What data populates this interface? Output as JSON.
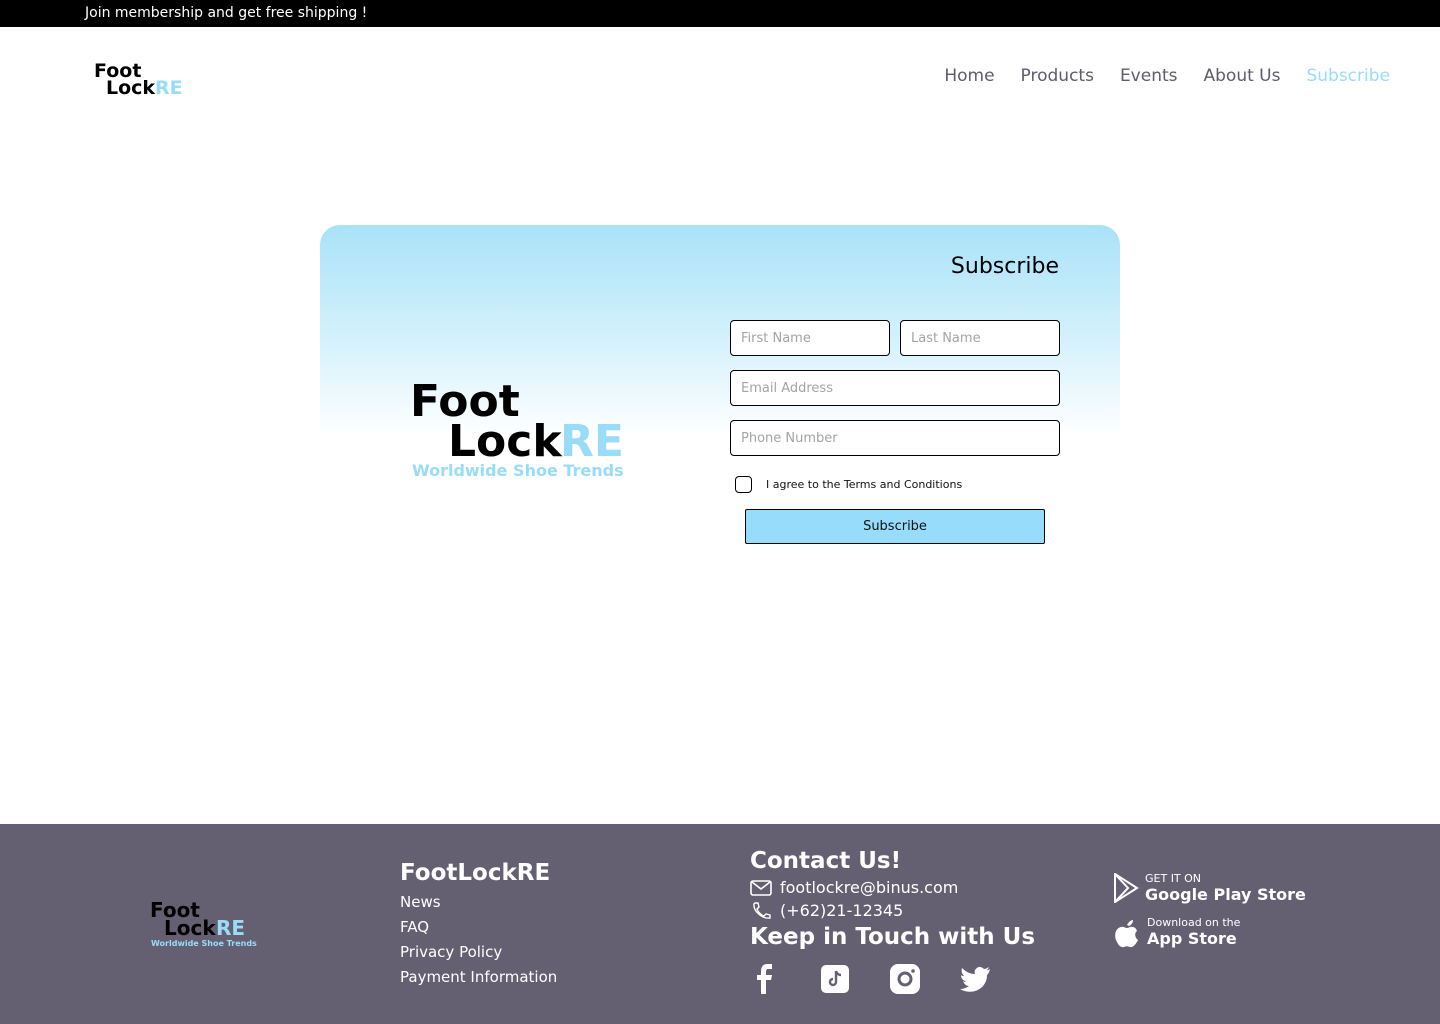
{
  "promo": {
    "text": "Join membership and get free shipping !"
  },
  "brand": {
    "part1": "Foot",
    "part2": "Lock",
    "part3": "RE",
    "tagline": "Worldwide Shoe Trends",
    "accent": "#98dcf8"
  },
  "nav": {
    "items": [
      "Home",
      "Products",
      "Events",
      "About Us",
      "Subscribe"
    ],
    "active": "Subscribe"
  },
  "subscribe": {
    "title": "Subscribe",
    "first_name_placeholder": "First Name",
    "last_name_placeholder": "Last Name",
    "email_placeholder": "Email Address",
    "phone_placeholder": "Phone Number",
    "agree_label": "I agree to the Terms and Conditions",
    "button_label": "Subscribe"
  },
  "footer": {
    "bg": "#646071",
    "brand_title": "FootLockRE",
    "links": [
      "News",
      "FAQ",
      "Privacy Policy",
      "Payment Information"
    ],
    "contact_title": "Contact Us!",
    "email": "footlockre@binus.com",
    "phone": "(+62)21-12345",
    "social_title": "Keep in Touch with Us",
    "socials": [
      "facebook-icon",
      "tiktok-icon",
      "instagram-icon",
      "twitter-icon"
    ],
    "google_small": "GET IT ON",
    "google_big": "Google Play Store",
    "apple_small": "Download on the",
    "apple_big": "App Store"
  }
}
